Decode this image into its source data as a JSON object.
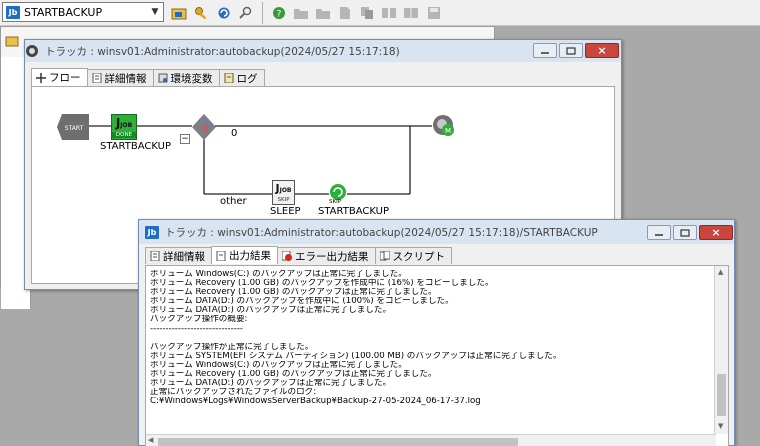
{
  "toolbar": {
    "job_selector": "STARTBACKUP",
    "icons": [
      "job-folder-icon",
      "key-icon",
      "refresh-icon",
      "search-icon",
      "help-icon",
      "folder-icon",
      "folder-icon",
      "document-icon",
      "copy-icon",
      "export-icon",
      "import-icon",
      "save-icon"
    ]
  },
  "tracker_window": {
    "title": "トラッカ : winsv01:Administrator:autobackup(2024/05/27 15:17:18)",
    "tabs": [
      {
        "label": "フロー",
        "active": true
      },
      {
        "label": "詳細情報",
        "active": false
      },
      {
        "label": "環境変数",
        "active": false
      },
      {
        "label": "ログ",
        "active": false
      }
    ],
    "flow": {
      "start_label": "START",
      "job_badge": "JOB",
      "done_badge": "DONE",
      "skip_badge": "SKIP",
      "nodes": [
        {
          "name": "STARTBACKUP"
        },
        {
          "name": "SLEEP"
        },
        {
          "name": "STARTBACKUP"
        }
      ],
      "branch_true": "0",
      "branch_other": "other",
      "collapse": "−"
    }
  },
  "output_window": {
    "title": "トラッカ : winsv01:Administrator:autobackup(2024/05/27 15:17:18)/STARTBACKUP",
    "tabs": [
      {
        "label": "詳細情報",
        "active": false
      },
      {
        "label": "出力結果",
        "active": true
      },
      {
        "label": "エラー出力結果",
        "active": false
      },
      {
        "label": "スクリプト",
        "active": false
      }
    ],
    "output_lines": [
      "ボリューム Windows(C:) のバックアップは正常に完了しました。",
      "ボリューム Recovery (1.00 GB) のバックアップを作成中に (16%) をコピーしました。",
      "ボリューム Recovery (1.00 GB) のバックアップは正常に完了しました。",
      "ボリューム DATA(D:) のバックアップを作成中に (100%) をコピーしました。",
      "ボリューム DATA(D:) のバックアップは正常に完了しました。",
      "バックアップ操作の概要:",
      "------------------------------",
      "",
      "バックアップ操作が正常に完了しました。",
      "ボリューム SYSTEM(EFI システム パーティション) (100.00 MB) のバックアップは正常に完了しました。",
      "ボリューム Windows(C:) のバックアップは正常に完了しました。",
      "ボリューム Recovery (1.00 GB) のバックアップは正常に完了しました。",
      "ボリューム DATA(D:) のバックアップは正常に完了しました。",
      "正常にバックアップされたファイルのログ:",
      "C:¥Windows¥Logs¥WindowsServerBackup¥Backup-27-05-2024_06-17-37.log"
    ]
  },
  "colors": {
    "title_bar": "#d8e4f1",
    "close_button": "#c9463d",
    "job_done": "#2fae3a",
    "flow_line": "#222222"
  }
}
